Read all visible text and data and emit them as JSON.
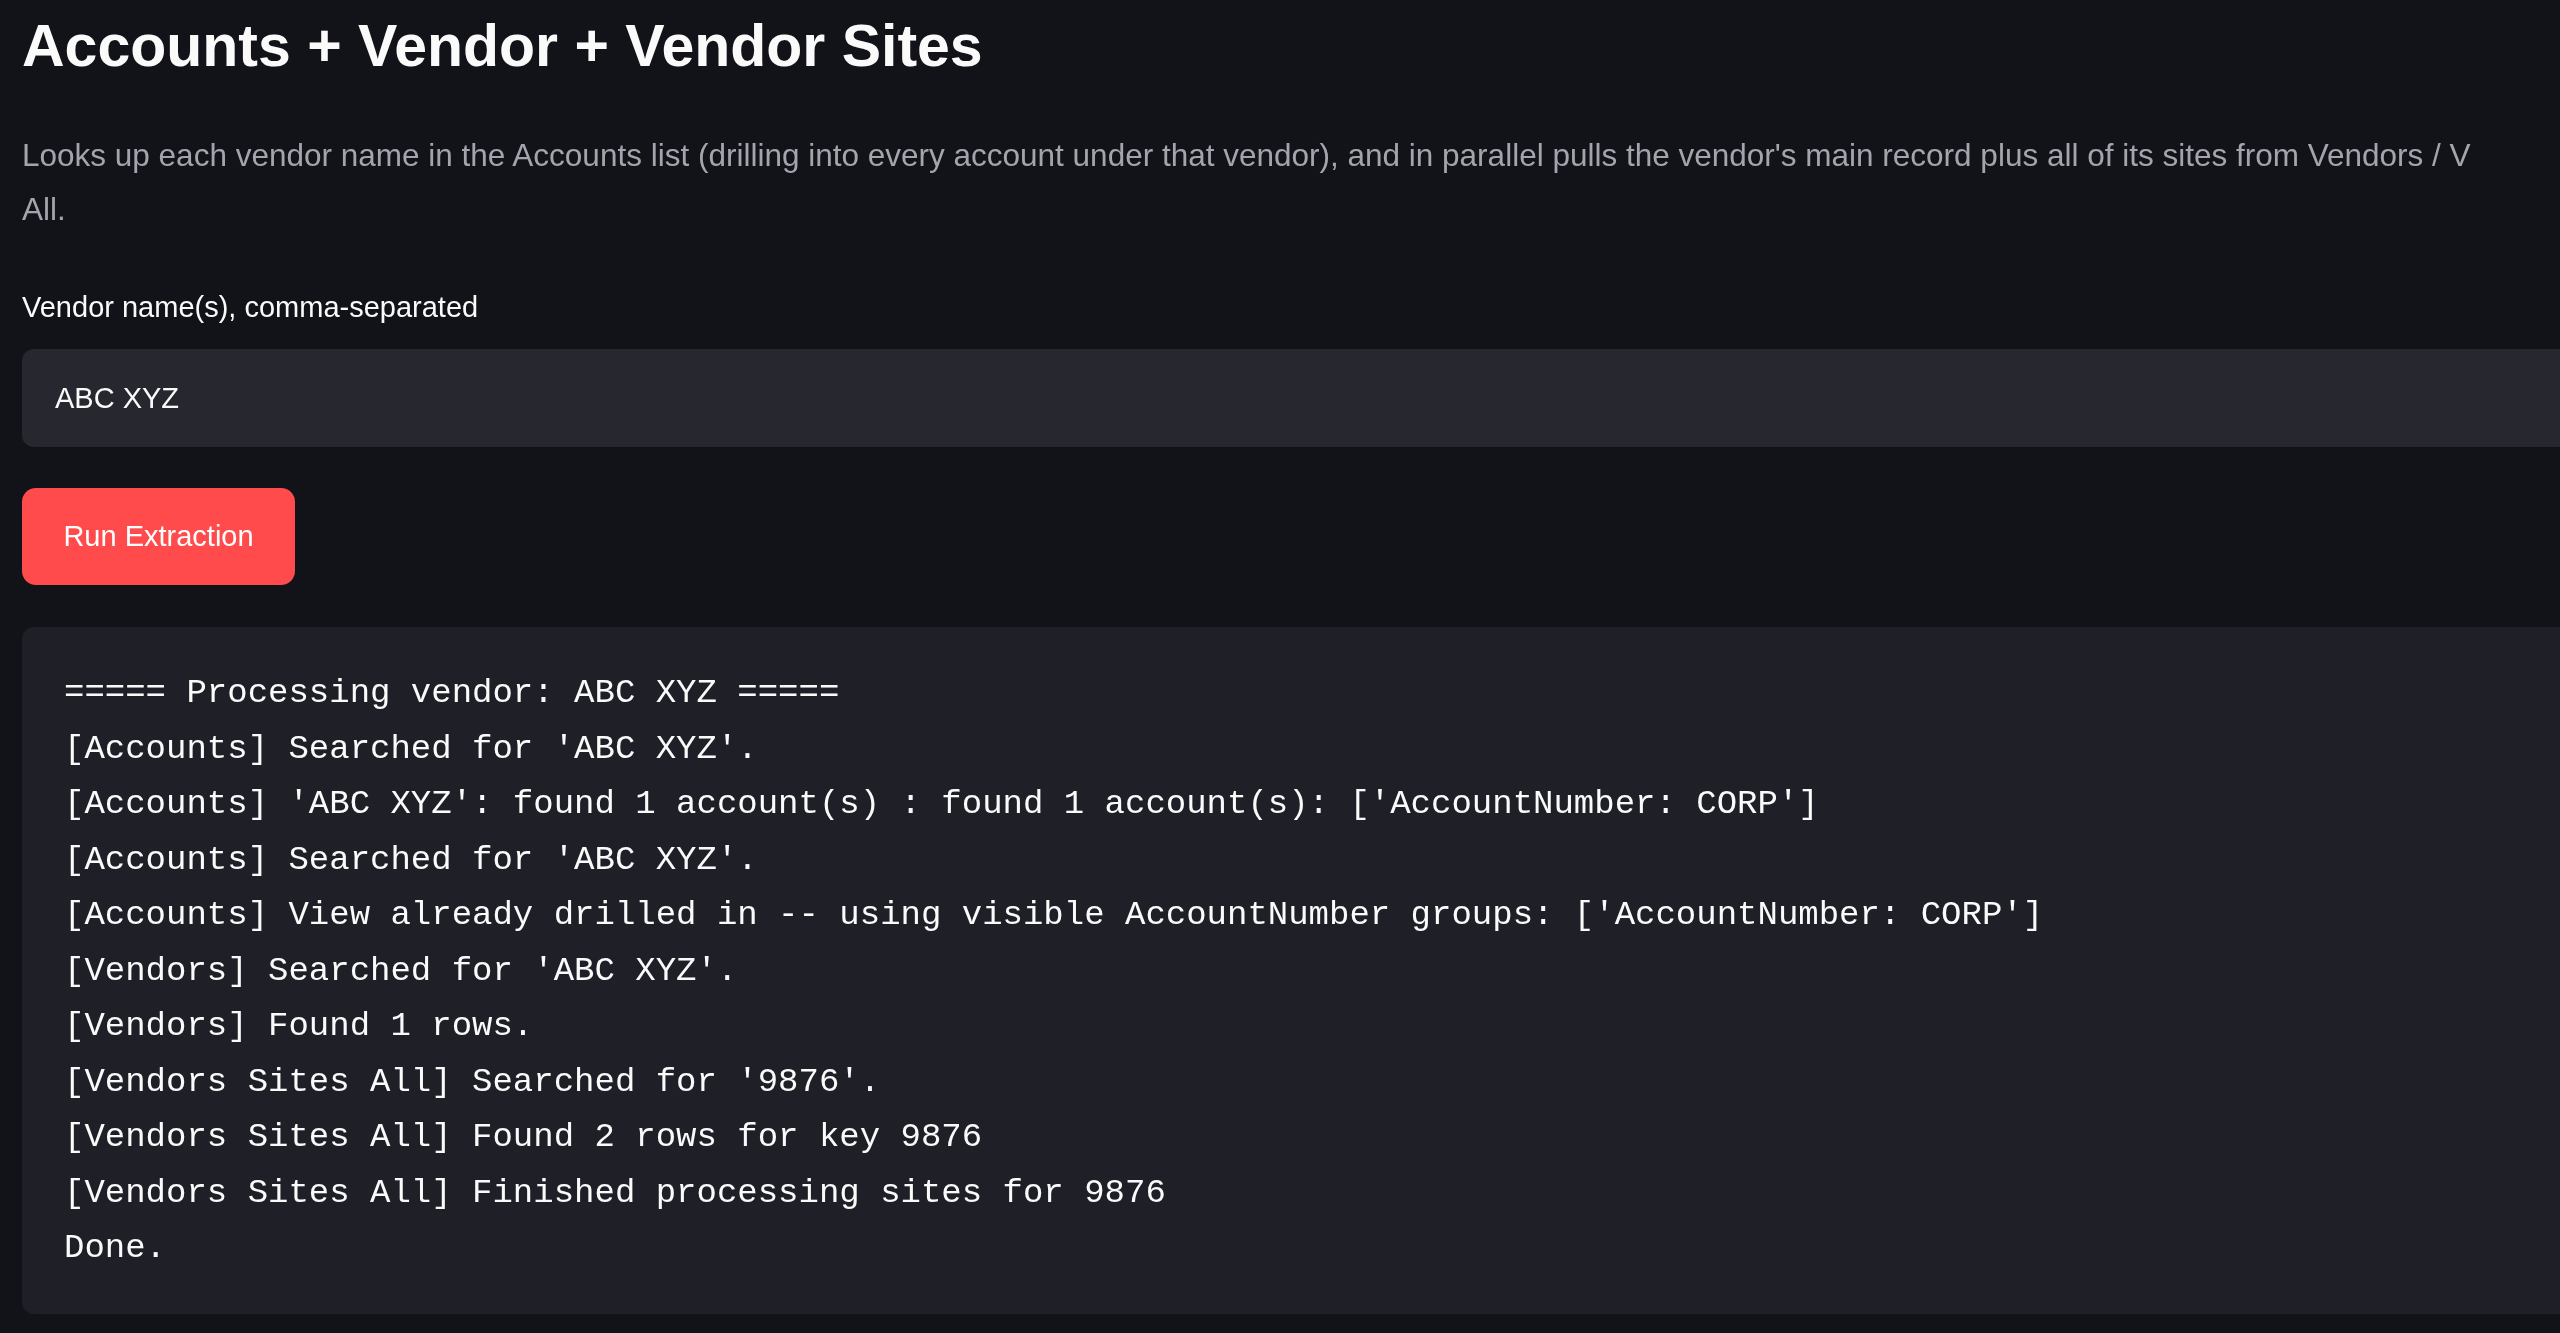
{
  "page": {
    "title": "Accounts + Vendor + Vendor Sites",
    "description_lines": [
      "Looks up each vendor name in the Accounts list (drilling into every account under that vendor), and in parallel pulls the vendor's main record plus all of its sites from Vendors / V",
      "All."
    ]
  },
  "form": {
    "field": {
      "label": "Vendor name(s), comma-separated",
      "value": "ABC XYZ"
    },
    "button": {
      "label": "Run Extraction"
    }
  },
  "log": {
    "lines": [
      "===== Processing vendor: ABC XYZ =====",
      "[Accounts] Searched for 'ABC XYZ'.",
      "[Accounts] 'ABC XYZ': found 1 account(s) : found 1 account(s): ['AccountNumber: CORP']",
      "[Accounts] Searched for 'ABC XYZ'.",
      "[Accounts] View already drilled in -- using visible AccountNumber groups: ['AccountNumber: CORP']",
      "[Vendors] Searched for 'ABC XYZ'.",
      "[Vendors] Found 1 rows.",
      "[Vendors Sites All] Searched for '9876'.",
      "[Vendors Sites All] Found 2 rows for key 9876",
      "[Vendors Sites All] Finished processing sites for 9876",
      "Done."
    ]
  }
}
